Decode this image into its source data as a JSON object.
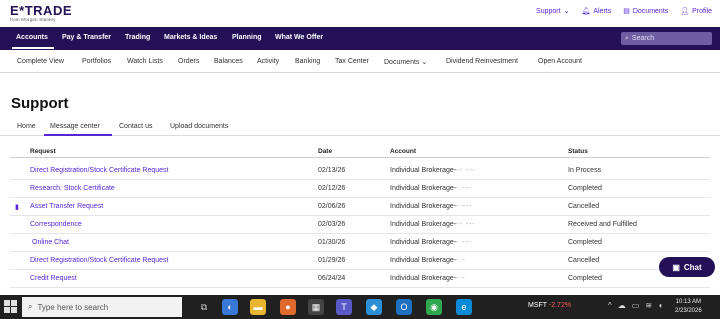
{
  "brand": {
    "logo": "E*TRADE",
    "sub": "from Morgan Stanley"
  },
  "top_links": [
    {
      "label": "Support",
      "icon": "chevron-down-icon"
    },
    {
      "label": "Alerts",
      "icon": "bell-icon"
    },
    {
      "label": "Documents",
      "icon": "document-icon"
    },
    {
      "label": "Profile",
      "icon": "person-icon"
    }
  ],
  "main_nav": [
    "Accounts",
    "Pay & Transfer",
    "Trading",
    "Markets & Ideas",
    "Planning",
    "What We Offer"
  ],
  "search": {
    "placeholder": "Search"
  },
  "sub_nav": [
    "Complete View",
    "Portfolios",
    "Watch Lists",
    "Orders",
    "Balances",
    "Activity",
    "Banking",
    "Tax Center",
    "Documents",
    "Dividend Reinvestment",
    "Open Account"
  ],
  "page": {
    "title": "Support"
  },
  "tabs": [
    "Home",
    "Message center",
    "Contact us",
    "Upload documents"
  ],
  "table": {
    "headers": [
      "Request",
      "Date",
      "Account",
      "Status"
    ],
    "rows": [
      {
        "request": "Direct Registration/Stock Certificate Request",
        "date": "02/13/26",
        "account": "Individual Brokerage-",
        "mask": "-- ---",
        "status": "In Process"
      },
      {
        "request": "Research: Stock Certificate",
        "date": "02/12/26",
        "account": "Individual Brokerage-",
        "mask": "- ---",
        "status": "Completed"
      },
      {
        "request": "Asset Transfer Request",
        "date": "02/06/26",
        "account": "Individual Brokerage-",
        "mask": "- ---",
        "status": "Cancelled"
      },
      {
        "request": "Correspondence",
        "date": "02/03/26",
        "account": "Individual Brokerage-",
        "mask": "-- ---",
        "status": "Received and Fulfilled"
      },
      {
        "request": "Online Chat",
        "date": "01/30/26",
        "account": "Individual Brokerage-",
        "mask": "- ---",
        "status": "Completed"
      },
      {
        "request": "Direct Registration/Stock Certificate Request",
        "date": "01/29/26",
        "account": "Individual Brokerage-",
        "mask": "- -",
        "status": "Cancelled"
      },
      {
        "request": "Credit Request",
        "date": "06/24/24",
        "account": "Individual Brokerage-",
        "mask": "- -",
        "status": "Completed"
      }
    ]
  },
  "chat_button": "Chat",
  "taskbar": {
    "search_placeholder": "Type here to search",
    "stock_symbol": "MSFT",
    "stock_change": "-2.72%",
    "time": "10:13 AM",
    "date": "2/23/2026"
  },
  "colors": {
    "brand_purple": "#241056",
    "link_purple": "#5627d8"
  }
}
